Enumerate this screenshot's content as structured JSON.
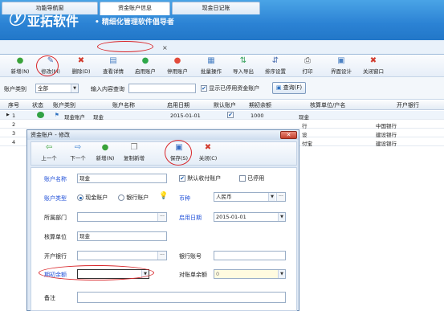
{
  "app": {
    "logo_icon": "yatuo-logo-icon",
    "brand": "亚拓软件",
    "slogan": "• 精细化管理软件倡导者"
  },
  "tabs": [
    {
      "label": "功能导航窗"
    },
    {
      "label": "资金账户信息",
      "active": true,
      "close": "×"
    },
    {
      "label": "现金日记账"
    }
  ],
  "toolbar": [
    {
      "icon": "add-icon",
      "glyph": "●",
      "color": "#3aa33a",
      "label": "新增(N)"
    },
    {
      "icon": "edit-icon",
      "glyph": "✎",
      "color": "#4c6fb0",
      "label": "修改(M)"
    },
    {
      "icon": "delete-icon",
      "glyph": "✖",
      "color": "#d23b2e",
      "label": "删除(D)"
    },
    {
      "icon": "details-icon",
      "glyph": "▤",
      "color": "#4c82c4",
      "label": "查看详情"
    },
    {
      "icon": "enable-icon",
      "glyph": "●",
      "color": "#2ea84a",
      "label": "启用账户"
    },
    {
      "icon": "disable-icon",
      "glyph": "●",
      "color": "#e24b3b",
      "label": "停用账户"
    },
    {
      "icon": "batch-icon",
      "glyph": "▦",
      "color": "#4c82c4",
      "label": "批量操作"
    },
    {
      "icon": "import-export-icon",
      "glyph": "⇅",
      "color": "#2e9e55",
      "label": "导入导出"
    },
    {
      "icon": "sort-icon",
      "glyph": "⇵",
      "color": "#4c6fb0",
      "label": "排序设置"
    },
    {
      "icon": "print-icon",
      "glyph": "⎙",
      "color": "#555555",
      "label": "打印"
    },
    {
      "icon": "layout-icon",
      "glyph": "▣",
      "color": "#4c82c4",
      "label": "界面设计"
    },
    {
      "icon": "close-window-icon",
      "glyph": "✖",
      "color": "#d23b2e",
      "label": "关闭窗口"
    }
  ],
  "filter": {
    "category_label": "账户类别",
    "category_value": "全部",
    "query_label": "输入内容查询",
    "query_value": "",
    "show_disabled_label": "显示已停用资金账户",
    "show_disabled_checked": true,
    "search_label": "查询(F)"
  },
  "grid": {
    "headers": [
      "序号",
      "状态",
      "账户类别",
      "账户名称",
      "启用日期",
      "默认账户",
      "期初余额",
      "核算单位/户名",
      "开户银行"
    ],
    "rows": [
      {
        "no": "1",
        "status_icon": "status-enabled-icon",
        "category": "现金账户",
        "name": "现金",
        "date": "2015-01-01",
        "default": true,
        "balance": "1000",
        "unit": "现金",
        "bank": ""
      },
      {
        "no": "2",
        "unit": "行",
        "bank": "中国银行"
      },
      {
        "no": "3",
        "unit": "设",
        "bank": "建设银行"
      },
      {
        "no": "4",
        "unit": "付宝",
        "bank": "建设银行"
      }
    ]
  },
  "dialog": {
    "title": "资金账户 - 修改",
    "close": "✕",
    "toolbar": [
      {
        "icon": "prev-icon",
        "glyph": "⇦",
        "color": "#3aa33a",
        "label": "上一个"
      },
      {
        "icon": "next-icon",
        "glyph": "⇨",
        "color": "#3a7fd0",
        "label": "下一个"
      },
      {
        "icon": "add-icon",
        "glyph": "●",
        "color": "#3aa33a",
        "label": "新增(N)"
      },
      {
        "icon": "copy-add-icon",
        "glyph": "❐",
        "color": "#777777",
        "label": "复制新增"
      },
      {
        "icon": "save-icon",
        "glyph": "▣",
        "color": "#3a6fc4",
        "label": "保存(S)"
      },
      {
        "icon": "close-icon",
        "glyph": "✖",
        "color": "#d23b2e",
        "label": "关闭(C)"
      }
    ],
    "fields": {
      "name_label": "账户名称",
      "name_value": "现金",
      "default_pay_label": "默认收付账户",
      "default_pay_checked": true,
      "disabled_label": "已停用",
      "disabled_checked": false,
      "type_label": "账户类型",
      "type_cash": "现金账户",
      "type_bank": "银行账户",
      "type_cash_selected": true,
      "currency_label": "币种",
      "currency_value": "人民币",
      "dept_label": "所属部门",
      "dept_value": "",
      "start_label": "启用日期",
      "start_value": "2015-01-01",
      "unit_label": "核算单位",
      "unit_value": "现金",
      "bank_label": "开户银行",
      "bank_value": "",
      "account_no_label": "银行账号",
      "account_no_value": "",
      "opening_label": "期初余额",
      "opening_value": "",
      "reconcile_label": "对账单余额",
      "reconcile_value": "0",
      "remark_label": "备注",
      "remark_value": ""
    }
  },
  "colors": {
    "banner": "#2b82d4",
    "highlight": "#d9262a",
    "field_blue": "#1f4fd8"
  }
}
